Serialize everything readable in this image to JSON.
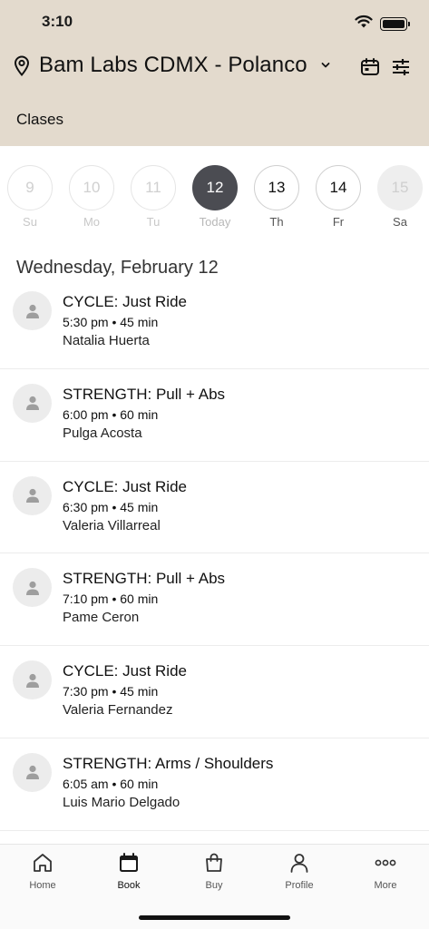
{
  "status_bar": {
    "time": "3:10"
  },
  "header": {
    "location": "Bam Labs CDMX - Polanco",
    "section_title": "Clases"
  },
  "date_strip": [
    {
      "number": "9",
      "label": "Su",
      "state": "past"
    },
    {
      "number": "10",
      "label": "Mo",
      "state": "past"
    },
    {
      "number": "11",
      "label": "Tu",
      "state": "past"
    },
    {
      "number": "12",
      "label": "Today",
      "state": "today"
    },
    {
      "number": "13",
      "label": "Th",
      "state": "future"
    },
    {
      "number": "14",
      "label": "Fr",
      "state": "future"
    },
    {
      "number": "15",
      "label": "Sa",
      "state": "disabled"
    }
  ],
  "schedule": {
    "date_heading": "Wednesday, February 12",
    "classes": [
      {
        "name": "CYCLE: Just Ride",
        "time": "5:30 pm • 45 min",
        "instructor": "Natalia Huerta"
      },
      {
        "name": "STRENGTH: Pull + Abs",
        "time": "6:00 pm • 60 min",
        "instructor": "Pulga Acosta"
      },
      {
        "name": "CYCLE: Just Ride",
        "time": "6:30 pm • 45 min",
        "instructor": "Valeria Villarreal"
      },
      {
        "name": "STRENGTH: Pull + Abs",
        "time": "7:10 pm • 60 min",
        "instructor": "Pame Ceron"
      },
      {
        "name": "CYCLE: Just Ride",
        "time": "7:30 pm • 45 min",
        "instructor": "Valeria Fernandez"
      },
      {
        "name": "STRENGTH: Arms / Shoulders",
        "time": "6:05 am • 60 min",
        "instructor": "Luis Mario Delgado"
      }
    ]
  },
  "tab_bar": {
    "items": [
      {
        "label": "Home",
        "icon": "home-icon"
      },
      {
        "label": "Book",
        "icon": "calendar-icon",
        "active": true
      },
      {
        "label": "Buy",
        "icon": "shopping-bag-icon"
      },
      {
        "label": "Profile",
        "icon": "person-icon"
      },
      {
        "label": "More",
        "icon": "ellipsis-icon"
      }
    ]
  },
  "colors": {
    "header_background": "#e3dacd",
    "today_circle": "#4b4c52",
    "avatar_background": "#ececec"
  }
}
